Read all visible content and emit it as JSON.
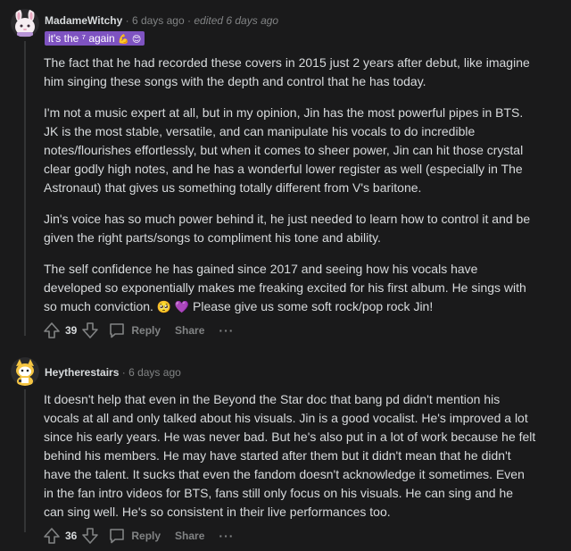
{
  "comments": [
    {
      "username": "MadameWitchy",
      "separator": "·",
      "time": "6 days ago",
      "edited": "edited 6 days ago",
      "flair": {
        "text": "it's the ⁷ again",
        "emojis": [
          "💪",
          "😊"
        ]
      },
      "avatar": "witch-avatar-icon",
      "paragraphs": [
        "The fact that he had recorded these covers in 2015 just 2 years after debut, like imagine\nhim singing these songs with the depth and control that he has today.",
        "I'm not a music expert at all, but in my opinion, Jin has the most powerful pipes in BTS.\nJK is the most stable, versatile, and can manipulate his vocals to do incredible\nnotes/flourishes effortlessly, but when it comes to sheer power, Jin can hit those crystal\nclear godly high notes, and he has a wonderful lower register as well (especially in The\nAstronaut) that gives us something totally different from V's baritone.",
        "Jin's voice has so much power behind it, he just needed to learn how to control it and be\ngiven the right parts/songs to compliment his tone and ability.",
        "The self confidence he has gained since 2017 and seeing how his vocals have\ndeveloped so exponentially makes me freaking excited for his first album. He sings with\nso much conviction."
      ],
      "paragraph_tail": {
        "emojis": [
          "🥺",
          "💜"
        ],
        "text": "Please give us some soft rock/pop rock Jin!"
      },
      "score": "39",
      "reply_label": "Reply",
      "share_label": "Share",
      "more_label": "···"
    },
    {
      "username": "Heytherestairs",
      "separator": "·",
      "time": "6 days ago",
      "avatar": "cat-avatar-icon",
      "paragraphs": [
        "It doesn't help that even in the Beyond the Star doc that bang pd didn't mention his\nvocals at all and only talked about his visuals. Jin is a good vocalist. He's improved a lot\nsince his early years. He was never bad. But he's also put in a lot of work because he felt\nbehind his members. He may have started after them but it didn't mean that he didn't\nhave the talent. It sucks that even the fandom doesn't acknowledge it sometimes. Even\nin the fan intro videos for BTS, fans still only focus on his visuals. He can sing and he\ncan sing well. He's so consistent in their live performances too."
      ],
      "score": "36",
      "reply_label": "Reply",
      "share_label": "Share",
      "more_label": "···"
    }
  ],
  "colors": {
    "background": "#1a1a1b",
    "text": "#d7dadc",
    "muted": "#818384",
    "flair": "#7e53c1",
    "thread_line": "#343536"
  }
}
